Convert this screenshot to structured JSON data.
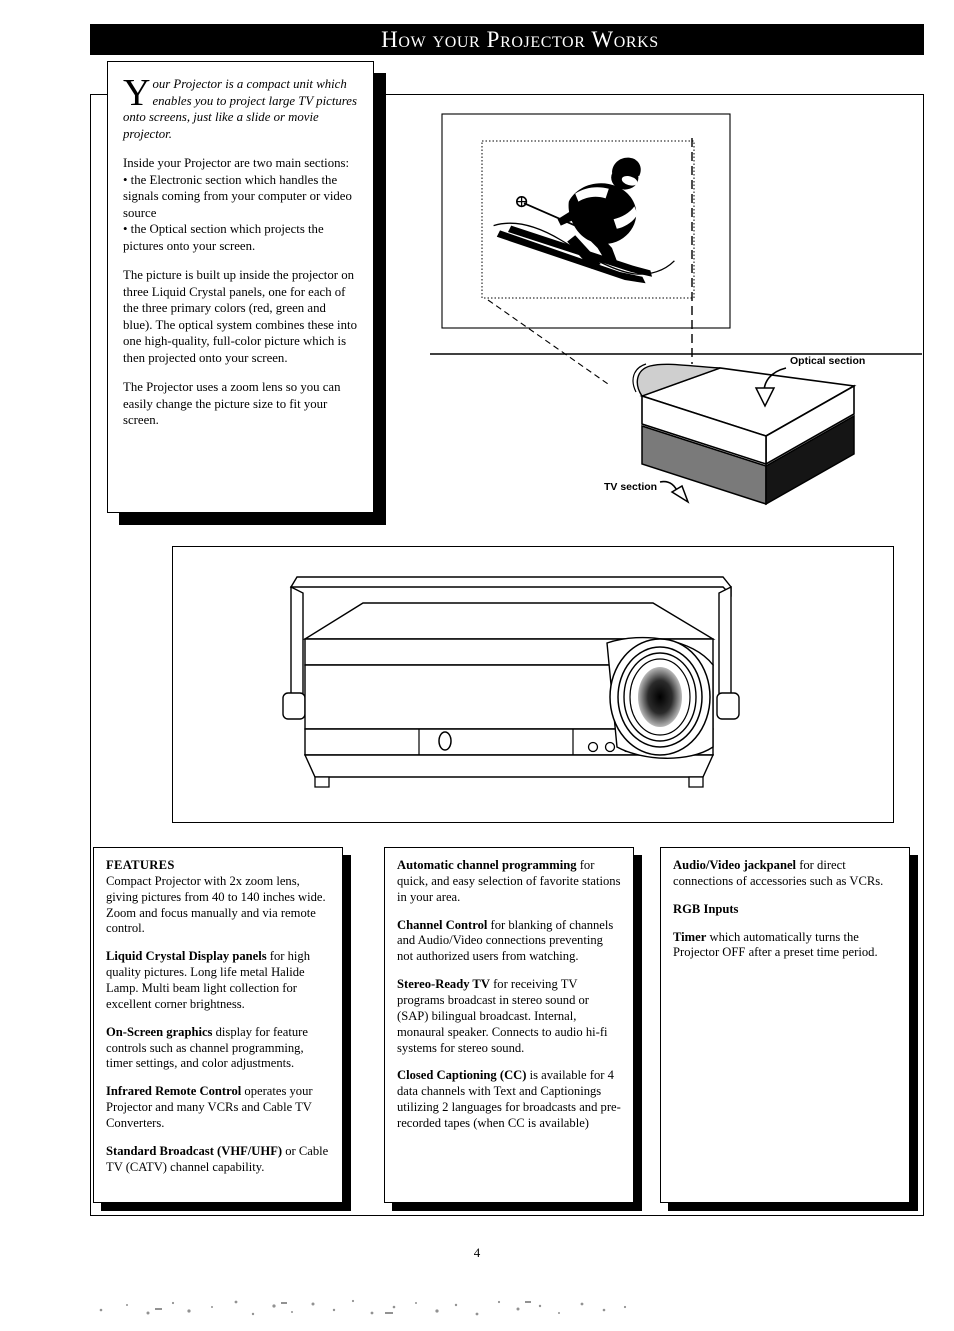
{
  "header": {
    "title": "How your Projector Works"
  },
  "intro": {
    "para1_dropcap": "Y",
    "para1_italic": "our  Projector is a compact unit which enables you to project  large TV pictures onto screens, just like a slide or movie projector.",
    "para2": "Inside your Projector are two main sections:",
    "bullet1": "• the Electronic section which handles the signals coming from your computer or video source",
    "bullet2": "• the Optical section which projects the pictures onto your screen.",
    "para3": "The picture is built up inside the projector on three Liquid Crystal panels, one for each of the three primary colors (red, green and blue). The optical system combines these into one high-quality, full-color picture which is then projected onto your screen.",
    "para4": "The Projector uses a zoom lens so you can easily change the picture size to fit your screen."
  },
  "diagram": {
    "label_optical": "Optical section",
    "label_tv": "TV section",
    "image_subject": "skier"
  },
  "photo": {
    "caption": ""
  },
  "features": {
    "heading": "FEATURES",
    "col1": [
      {
        "bold": "",
        "text": "Compact Projector with 2x zoom lens, giving pictures from 40 to 140 inches wide. Zoom and focus manually and via remote control."
      },
      {
        "bold": "Liquid Crystal Display panels",
        "text": " for high quality pictures. Long life metal Halide Lamp. Multi beam light collection for excellent corner brightness."
      },
      {
        "bold": "On-Screen graphics",
        "text": " display for feature controls such as channel programming, timer settings, and color adjustments."
      },
      {
        "bold": "Infrared Remote Control",
        "text": " operates your Projector and many VCRs and Cable TV Converters."
      },
      {
        "bold": "Standard Broadcast (VHF/UHF)",
        "text": " or Cable TV (CATV) channel capability."
      }
    ],
    "col2": [
      {
        "bold": "Automatic channel programming",
        "text": " for quick, and easy selection of favorite stations in your area."
      },
      {
        "bold": "Channel Control",
        "text": " for blanking of channels and Audio/Video connections preventing not authorized users from watching."
      },
      {
        "bold": "Stereo-Ready TV",
        "text": " for receiving TV programs broadcast in stereo sound or (SAP) bilingual broadcast. Internal, monaural speaker. Connects to audio hi-fi systems for stereo sound."
      },
      {
        "bold": "Closed Captioning (CC)",
        "text": " is available for 4 data channels with Text and Captionings utilizing 2 languages for broadcasts and pre-recorded tapes (when CC is available)"
      }
    ],
    "col3": [
      {
        "bold": "Audio/Video jackpanel",
        "text": " for direct connections of accessories such as VCRs."
      },
      {
        "bold": "RGB Inputs",
        "text": ""
      },
      {
        "bold": "Timer",
        "text": " which automatically turns the Projector OFF after a preset time period."
      }
    ]
  },
  "footer": {
    "page_number": "4"
  },
  "colors": {
    "ink": "#000000",
    "paper": "#ffffff"
  }
}
